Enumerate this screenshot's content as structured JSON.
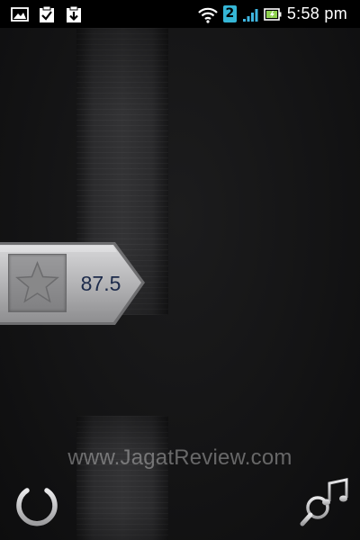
{
  "status_bar": {
    "left_icons": [
      "image-icon",
      "clipboard-check-icon",
      "download-icon"
    ],
    "wifi_icon": "wifi-icon",
    "sim_label": "2",
    "signal_icon": "signal-icon",
    "battery_icon": "battery-charging-icon",
    "time": "5:58 pm",
    "colors": {
      "sim_badge": "#35b6d6",
      "signal": "#3fb6e0",
      "battery": "#8fd14f"
    }
  },
  "radio": {
    "frequency": "87.5",
    "favorite_icon": "star-icon"
  },
  "controls": {
    "power_icon": "power-icon",
    "search_music_icon": "search-music-icon"
  },
  "watermark": "www.JagatReview.com"
}
